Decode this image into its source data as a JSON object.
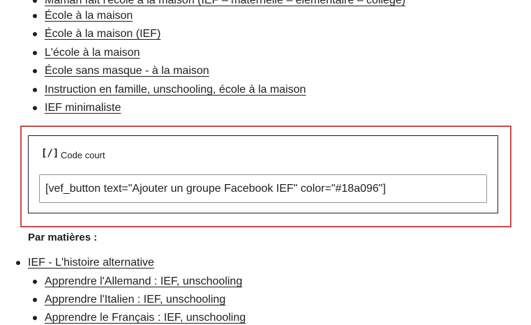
{
  "list_top": {
    "cut_item": "Maman fait l'école à la maison (IEF – maternelle – élémentaire – collège)",
    "items": [
      "École à la maison",
      "École à la maison (IEF)",
      "L'école à la maison",
      "École sans masque - à la maison",
      "Instruction en famille, unschooling, école à la maison",
      "IEF minimaliste"
    ]
  },
  "shortcode_block": {
    "icon": "[/]",
    "label": "Code court",
    "value": "[vef_button text=\"Ajouter un groupe Facebook IEF\" color=\"#18a096\"]"
  },
  "section": {
    "heading": "Par matières :",
    "parent_item": "IEF - L'histoire alternative",
    "sub_items": [
      "Apprendre l'Allemand : IEF, unschooling",
      "Apprendre l'Italien : IEF, unschooling",
      "Apprendre le Français : IEF, unschooling"
    ]
  },
  "colors": {
    "highlight_border": "#cc4a4a",
    "text": "#1e1e1e",
    "spellcheck": "#d63638"
  }
}
